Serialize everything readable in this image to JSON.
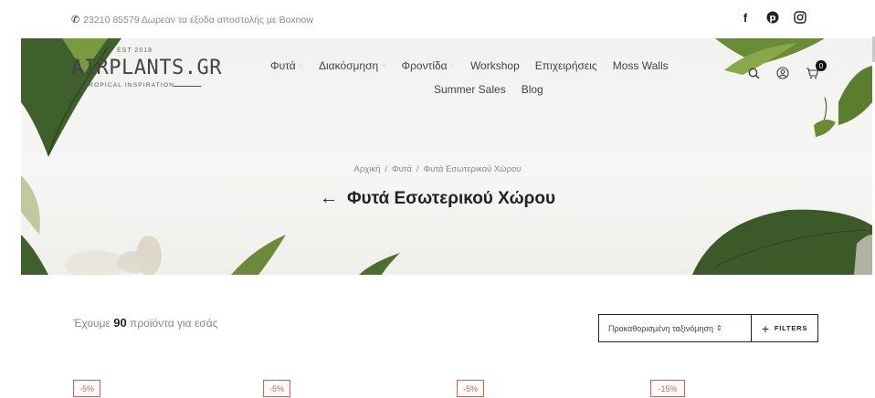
{
  "topbar": {
    "phone_text": "23210 85579 Δωρεάν τα έξοδα αποστολής με Boxnow",
    "social": [
      "facebook-icon",
      "pinterest-icon",
      "instagram-icon"
    ]
  },
  "logo": {
    "est": "EST 2018",
    "name": "AIRPLANTS.GR",
    "tagline": "TROPICAL INSPIRATION"
  },
  "nav": {
    "items": [
      {
        "label": "Φυτά",
        "has_dropdown": true
      },
      {
        "label": "Διακόσμηση",
        "has_dropdown": true
      },
      {
        "label": "Φροντίδα",
        "has_dropdown": true
      },
      {
        "label": "Workshop",
        "has_dropdown": false
      },
      {
        "label": "Επιχειρήσεις",
        "has_dropdown": false
      },
      {
        "label": "Moss Walls",
        "has_dropdown": false
      }
    ],
    "row2": [
      {
        "label": "Summer Sales"
      },
      {
        "label": "Blog"
      }
    ]
  },
  "header_icons": {
    "search": "search-icon",
    "account": "account-icon",
    "cart": "cart-icon",
    "cart_count": "0"
  },
  "breadcrumb": {
    "items": [
      "Αρχική",
      "Φυτά",
      "Φυτά Εσωτερικού Χώρου"
    ],
    "separator": "/"
  },
  "page_title": "Φυτά Εσωτερικού Χώρου",
  "toolbar": {
    "count_prefix": "Έχουμε",
    "count_value": "90",
    "count_suffix": "προϊόντα για εσάς",
    "sort_label": "Προκαθορισμένη ταξινόμηση",
    "filters_label": "FILTERS"
  },
  "badges": [
    "-5%",
    "-5%",
    "-5%",
    "-15%"
  ],
  "colors": {
    "badge": "#e8584c",
    "leaf_dark": "#3f5f2c",
    "leaf_light": "#8aa84a"
  }
}
